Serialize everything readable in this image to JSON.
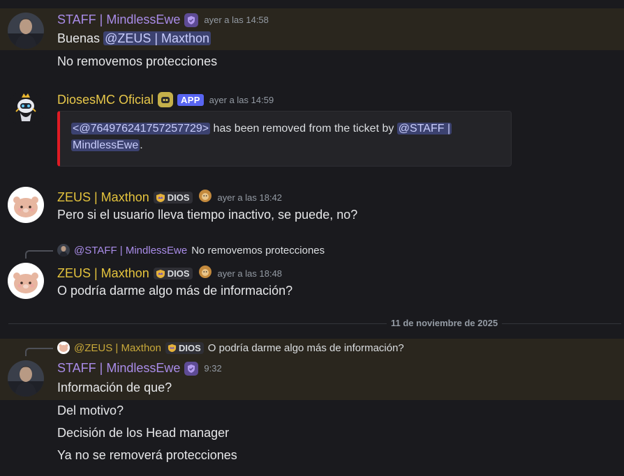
{
  "messages": {
    "m1": {
      "username": "STAFF | MindlessEwe",
      "timestamp": "ayer a las 14:58",
      "line1_prefix": "Buenas",
      "line1_mention": "@ZEUS | Maxthon",
      "line2": "No removemos protecciones"
    },
    "m2": {
      "username": "DiosesMC Oficial",
      "app_tag": "APP",
      "timestamp": "ayer a las 14:59",
      "embed_mention1": "<@764976241757257729>",
      "embed_middle": " has been removed from the ticket by ",
      "embed_mention2a": "@STAFF |",
      "embed_mention2b": "MindlessEwe",
      "embed_suffix": "."
    },
    "m3": {
      "username": "ZEUS | Maxthon",
      "role": "DIOS",
      "timestamp": "ayer a las 18:42",
      "line1": "Pero si el usuario lleva tiempo inactivo, se puede, no?"
    },
    "m4": {
      "reply_name": "@STAFF | MindlessEwe",
      "reply_text": "No removemos protecciones",
      "username": "ZEUS | Maxthon",
      "role": "DIOS",
      "timestamp": "ayer a las 18:48",
      "line1": "O podría darme algo más de información?"
    },
    "m5": {
      "reply_name": "@ZEUS | Maxthon",
      "reply_role": "DIOS",
      "reply_text": "O podría darme algo más de información?",
      "username": "STAFF | MindlessEwe",
      "timestamp": "9:32",
      "line1": "Información de que?",
      "line2": "Del motivo?",
      "line3": "Decisión de los Head manager",
      "line4": "Ya no se removerá protecciones"
    }
  },
  "date_divider": "11 de noviembre de 2025",
  "colors": {
    "background": "#1a1a1e",
    "highlight": "#2a261e",
    "staff_name": "#a98ce8",
    "zeus_name": "#e5c43d",
    "mention_bg": "#3c4270",
    "app_tag": "#5865f2",
    "embed_border": "#e01b24"
  },
  "icons": {
    "verified": "shield-check-icon",
    "bot": "bot-icon",
    "role": "crown-shield-icon",
    "deco": "lion-icon"
  }
}
